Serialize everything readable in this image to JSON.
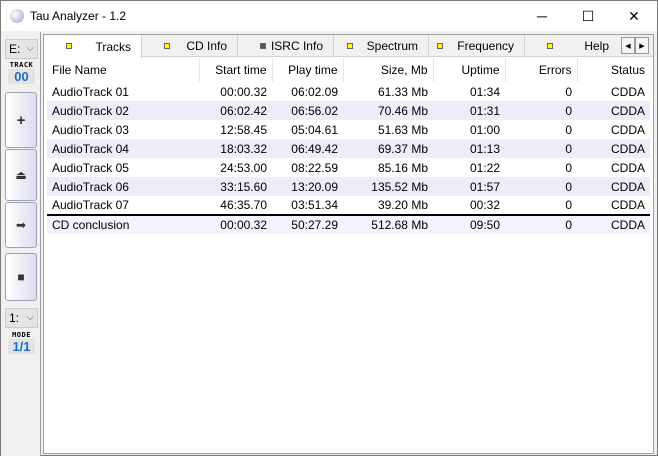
{
  "window": {
    "title": "Tau Analyzer - 1.2",
    "minimize": "─",
    "maximize": "☐",
    "close": "✕"
  },
  "left": {
    "drive": "E:",
    "track_label": "TRACK",
    "track_value": "00",
    "buttons": [
      "+",
      "⏏",
      "➡",
      "■"
    ],
    "mode_select": "1:",
    "mode_label": "MODE",
    "mode_value": "1/1"
  },
  "tabs": [
    {
      "label": "Tracks",
      "icon": "yellow"
    },
    {
      "label": "CD Info",
      "icon": "yellow"
    },
    {
      "label": "ISRC Info",
      "icon": "dark"
    },
    {
      "label": "Spectrum",
      "icon": "yellow"
    },
    {
      "label": "Frequency",
      "icon": "yellow"
    },
    {
      "label": "Help",
      "icon": "yellow"
    }
  ],
  "table": {
    "headers": [
      "File Name",
      "Start time",
      "Play time",
      "Size, Mb",
      "Uptime",
      "Errors",
      "Status"
    ],
    "rows": [
      [
        "AudioTrack 01",
        "00:00.32",
        "06:02.09",
        "61.33 Mb",
        "01:34",
        "0",
        "CDDA"
      ],
      [
        "AudioTrack 02",
        "06:02.42",
        "06:56.02",
        "70.46 Mb",
        "01:31",
        "0",
        "CDDA"
      ],
      [
        "AudioTrack 03",
        "12:58.45",
        "05:04.61",
        "51.63 Mb",
        "01:00",
        "0",
        "CDDA"
      ],
      [
        "AudioTrack 04",
        "18:03.32",
        "06:49.42",
        "69.37 Mb",
        "01:13",
        "0",
        "CDDA"
      ],
      [
        "AudioTrack 05",
        "24:53.00",
        "08:22.59",
        "85.16 Mb",
        "01:22",
        "0",
        "CDDA"
      ],
      [
        "AudioTrack 06",
        "33:15.60",
        "13:20.09",
        "135.52 Mb",
        "01:57",
        "0",
        "CDDA"
      ],
      [
        "AudioTrack 07",
        "46:35.70",
        "03:51.34",
        "39.20 Mb",
        "00:32",
        "0",
        "CDDA"
      ]
    ],
    "conclusion": [
      "CD conclusion",
      "00:00.32",
      "50:27.29",
      "512.68 Mb",
      "09:50",
      "0",
      "CDDA"
    ]
  }
}
